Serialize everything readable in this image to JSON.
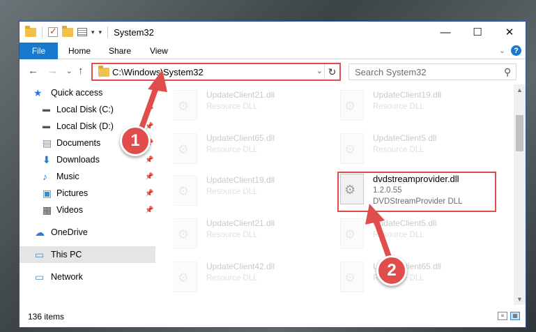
{
  "window": {
    "title": "System32",
    "controls": {
      "minimize": "—",
      "maximize": "☐",
      "close": "✕"
    }
  },
  "ribbon": {
    "tabs": [
      "File",
      "Home",
      "Share",
      "View"
    ]
  },
  "address": {
    "path": "C:\\Windows\\System32"
  },
  "search": {
    "placeholder": "Search System32"
  },
  "nav": {
    "items": [
      {
        "label": "Quick access",
        "icon": "star-icon"
      },
      {
        "label": "Local Disk (C:)",
        "icon": "drive-icon",
        "pinned": true
      },
      {
        "label": "Local Disk (D:)",
        "icon": "drive-icon",
        "pinned": true
      },
      {
        "label": "Documents",
        "icon": "documents-icon",
        "pinned": true
      },
      {
        "label": "Downloads",
        "icon": "download-icon",
        "pinned": true
      },
      {
        "label": "Music",
        "icon": "music-icon",
        "pinned": true
      },
      {
        "label": "Pictures",
        "icon": "pictures-icon",
        "pinned": true
      },
      {
        "label": "Videos",
        "icon": "videos-icon",
        "pinned": true
      },
      {
        "label": "OneDrive",
        "icon": "cloud-icon"
      },
      {
        "label": "This PC",
        "icon": "computer-icon",
        "selected": true
      },
      {
        "label": "Network",
        "icon": "network-icon"
      }
    ]
  },
  "files": [
    {
      "name": "UpdateClient21.dll",
      "desc": "Resource DLL",
      "faded": true
    },
    {
      "name": "UpdateClient19.dll",
      "desc": "Resource DLL",
      "faded": true
    },
    {
      "name": "UpdateClient65.dll",
      "desc": "Resource DLL",
      "faded": true
    },
    {
      "name": "UpdateClient5.dll",
      "desc": "Resource DLL",
      "faded": true
    },
    {
      "name": "UpdateClient19.dll",
      "desc": "Resource DLL",
      "faded": true
    },
    {
      "name": "dvdstreamprovider.dll",
      "version": "1.2.0.55",
      "desc": "DVDStreamProvider DLL",
      "faded": false
    },
    {
      "name": "UpdateClient21.dll",
      "desc": "Resource DLL",
      "faded": true
    },
    {
      "name": "UpdateClient5.dll",
      "desc": "Resource DLL",
      "faded": true
    },
    {
      "name": "UpdateClient42.dll",
      "desc": "Resource DLL",
      "faded": true
    },
    {
      "name": "UpdateClient65.dll",
      "desc": "Resource DLL",
      "faded": true
    }
  ],
  "status": {
    "item_count": "136 items"
  },
  "annotations": {
    "badge1": "1",
    "badge2": "2",
    "color": "#e14d4d"
  }
}
